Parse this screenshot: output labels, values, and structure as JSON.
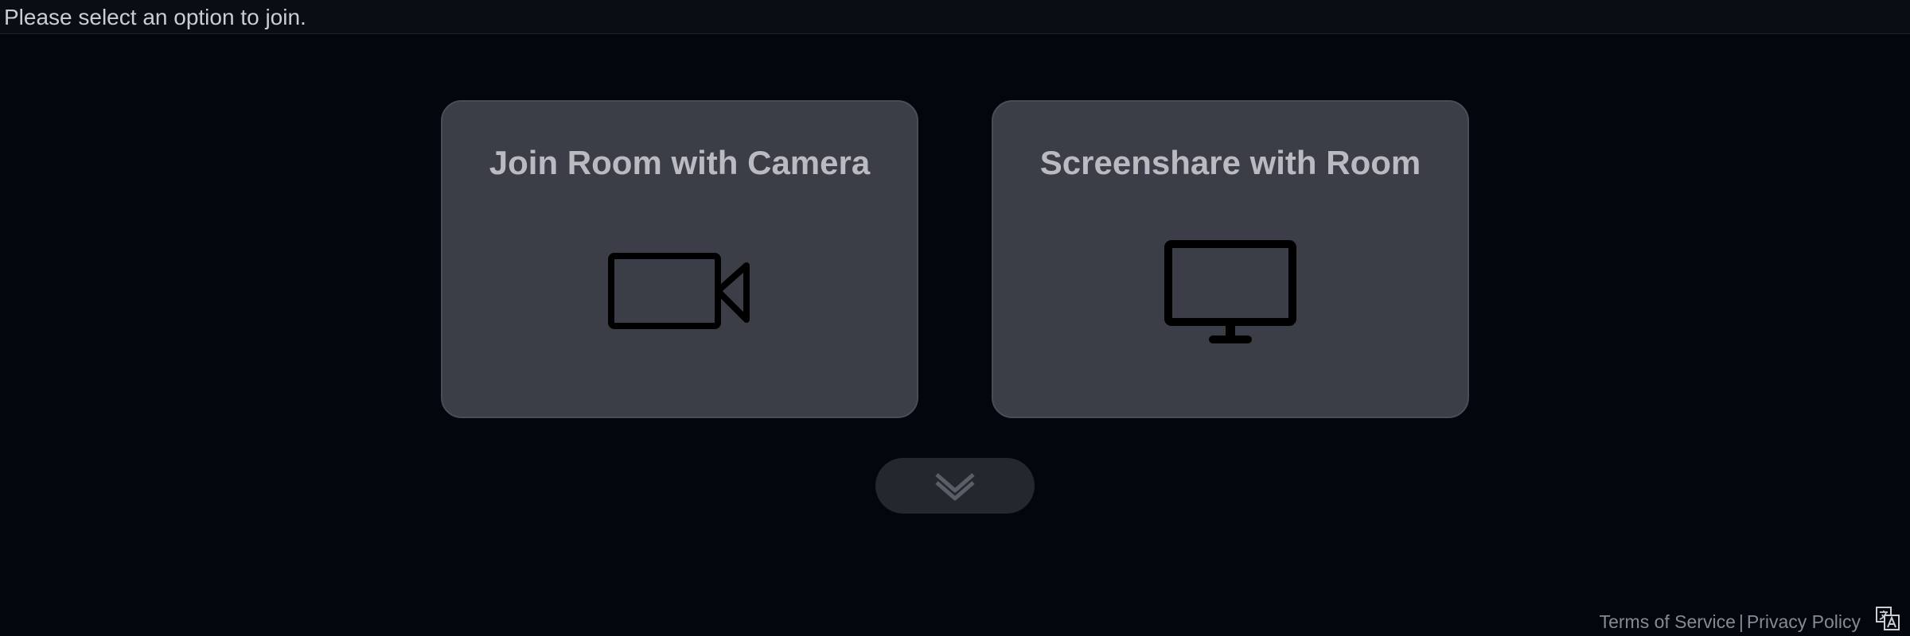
{
  "header": {
    "prompt": "Please select an option to join."
  },
  "options": [
    {
      "title": "Join Room with Camera",
      "icon": "video-camera-icon"
    },
    {
      "title": "Screenshare with Room",
      "icon": "monitor-icon"
    }
  ],
  "more_button": {
    "icon": "chevron-double-down-icon"
  },
  "footer": {
    "terms": "Terms of Service",
    "separator": "|",
    "privacy": "Privacy Policy",
    "language_icon": "translate-icon"
  },
  "colors": {
    "background": "#03060d",
    "card": "#3b3d47",
    "card_title": "#b9bbc1",
    "footer_text": "#868a93"
  }
}
